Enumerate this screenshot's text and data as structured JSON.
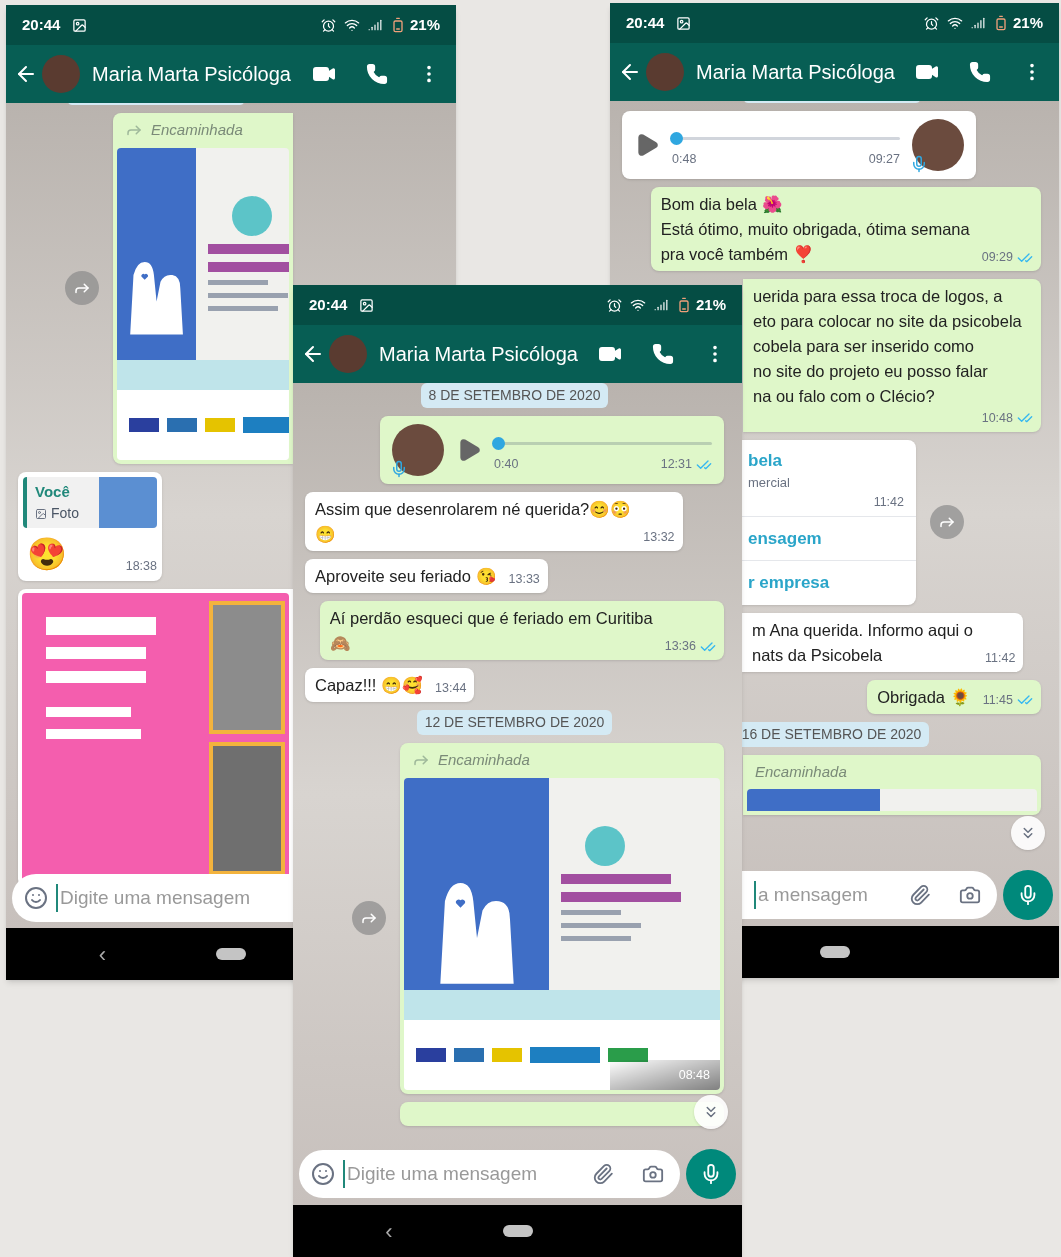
{
  "phones": [
    {
      "status_bar": {
        "time": "20:44",
        "battery": "21%"
      },
      "header": {
        "title": "Maria Marta Psicóloga"
      },
      "messages": [
        {
          "kind": "date"
        },
        {
          "kind": "forwarded",
          "outgoing": true,
          "label": "Encaminhada",
          "image": {
            "kind": "course_flyer"
          },
          "share_button": true
        },
        {
          "kind": "reply",
          "outgoing": false,
          "quoted_author": "Você",
          "quoted_text": "Foto",
          "lines": [
            "😍"
          ],
          "time": "18:38"
        },
        {
          "kind": "image",
          "outgoing": false,
          "image": {
            "kind": "event_flyer"
          }
        }
      ],
      "input": {
        "placeholder": "Digite uma mensagem",
        "emoji_button": true
      },
      "nav": {
        "back": "‹"
      }
    },
    {
      "status_bar": {
        "time": "20:44",
        "battery": "21%"
      },
      "header": {
        "title": "Maria Marta Psicóloga"
      },
      "messages": [
        {
          "kind": "date",
          "text": "8 DE SETEMBRO DE 2020"
        },
        {
          "kind": "audio",
          "outgoing": true,
          "duration": "0:40",
          "time": "12:31",
          "read": true,
          "level": 0
        },
        {
          "kind": "text",
          "outgoing": false,
          "lines": [
            "Assim que desenrolarem né querida?😊😳",
            "😁"
          ],
          "time": "13:32"
        },
        {
          "kind": "text",
          "outgoing": false,
          "lines": [
            "Aproveite seu feriado 😘"
          ],
          "time": "13:33"
        },
        {
          "kind": "text",
          "outgoing": true,
          "lines": [
            "Aí perdão esqueci que é feriado em Curitiba",
            "🙈"
          ],
          "time": "13:36",
          "read": true
        },
        {
          "kind": "text",
          "outgoing": false,
          "lines": [
            "Capaz!!! 😁🥰"
          ],
          "time": "13:44"
        },
        {
          "kind": "date",
          "text": "12 DE SETEMBRO DE 2020"
        },
        {
          "kind": "forwarded",
          "outgoing": true,
          "label": "Encaminhada",
          "image": {
            "kind": "course_flyer"
          },
          "time": "08:48",
          "share_button": true
        },
        {
          "kind": "forwarded",
          "outgoing": true
        }
      ],
      "scroll_button": true,
      "input": {
        "placeholder": "Digite uma mensagem",
        "emoji_button": true,
        "attach": true
      },
      "nav": {
        "back": "‹"
      }
    },
    {
      "status_bar": {
        "time": "20:44",
        "battery": "21%"
      },
      "header": {
        "title": "Maria Marta Psicóloga"
      },
      "messages": [
        {
          "kind": "date"
        },
        {
          "kind": "audio",
          "outgoing": false,
          "duration": "0:48",
          "time": "09:27",
          "level": 0
        },
        {
          "kind": "text",
          "outgoing": true,
          "lines": [
            "Bom dia bela 🌺",
            "Está ótimo, muito obrigada, ótima semana",
            "pra você também ❣️"
          ],
          "time": "09:29",
          "read": true
        },
        {
          "kind": "text",
          "outgoing": true,
          "lines": [
            "uerida para essa troca de logos, a",
            "eto para colocar no site da psicobela",
            "cobela para ser inserido como",
            "no site do projeto eu posso falar",
            "na ou falo com o Clécio?"
          ],
          "time": "10:48",
          "read": true
        },
        {
          "kind": "card",
          "outgoing": false,
          "title": "bela",
          "subtitle": "mercial",
          "time": "11:42",
          "actions": [
            "ensagem",
            "r empresa"
          ],
          "share_button": true
        },
        {
          "kind": "text",
          "outgoing": false,
          "lines": [
            "m Ana querida. Informo aqui o",
            "nats da Psicobela"
          ],
          "time": "11:42"
        },
        {
          "kind": "text",
          "outgoing": true,
          "lines": [
            "Obrigada 🌻"
          ],
          "time": "11:45",
          "read": true
        },
        {
          "kind": "date",
          "text": "16 DE SETEMBRO DE 2020"
        },
        {
          "kind": "forwarded",
          "outgoing": true,
          "label": "Encaminhada",
          "image": {
            "kind": "course_flyer"
          }
        }
      ],
      "scroll_button": true,
      "input": {
        "placeholder": "a mensagem",
        "attach": true
      }
    }
  ]
}
